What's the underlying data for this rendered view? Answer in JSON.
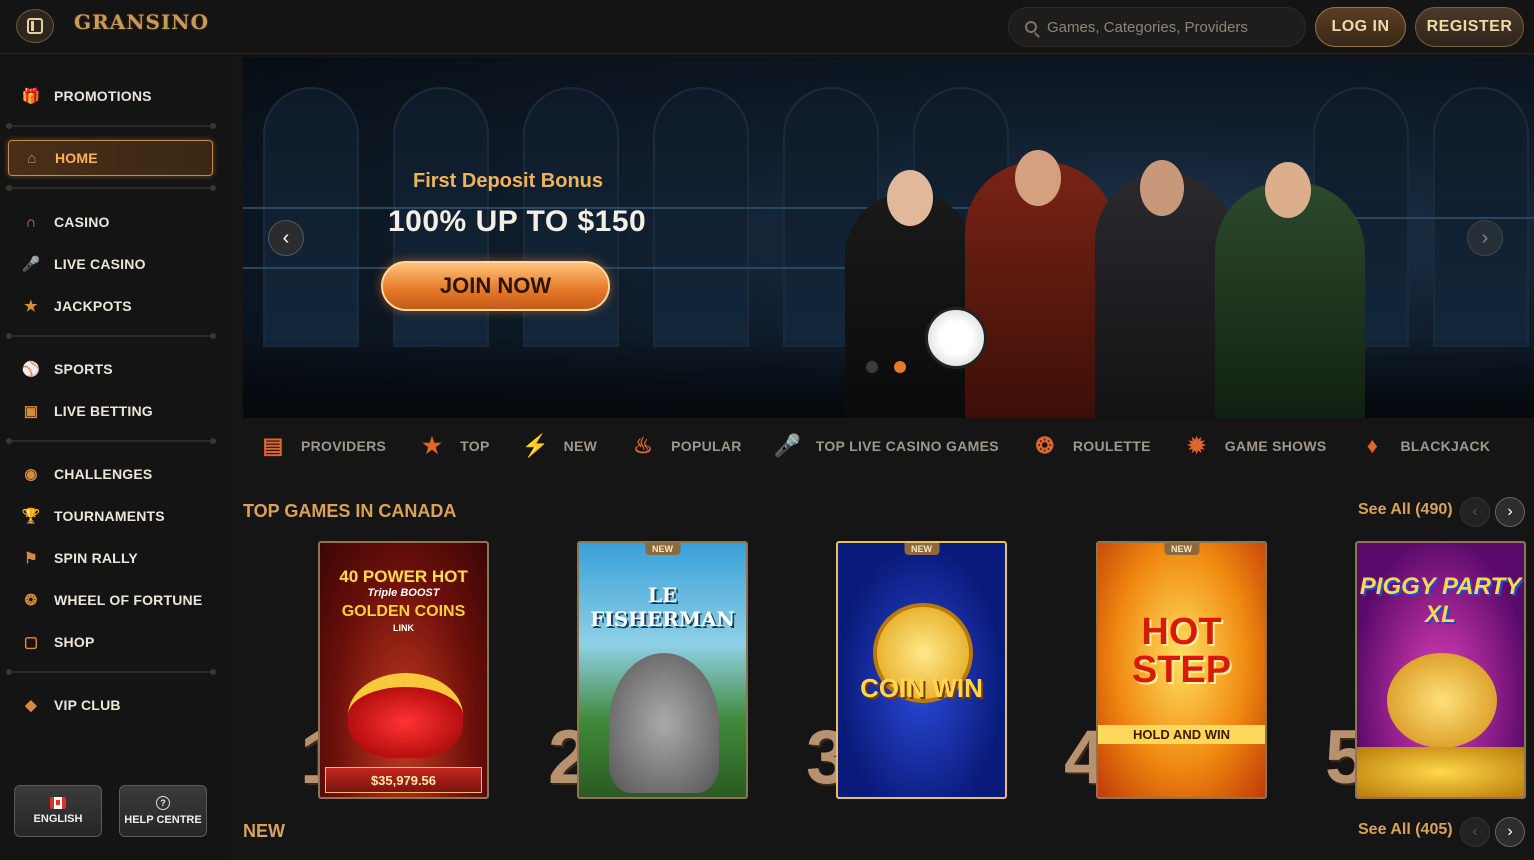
{
  "header": {
    "logo": "GRANSINO",
    "search_placeholder": "Games, Categories, Providers",
    "login_label": "LOG IN",
    "register_label": "REGISTER"
  },
  "sidebar": {
    "items": [
      {
        "label": "PROMOTIONS",
        "icon": "gift-icon"
      },
      {
        "label": "HOME",
        "icon": "home-icon",
        "active": true
      },
      {
        "label": "CASINO",
        "icon": "horseshoe-icon"
      },
      {
        "label": "LIVE CASINO",
        "icon": "microphone-icon"
      },
      {
        "label": "JACKPOTS",
        "icon": "jackpot-icon"
      },
      {
        "label": "SPORTS",
        "icon": "ball-icon"
      },
      {
        "label": "LIVE BETTING",
        "icon": "live-icon"
      },
      {
        "label": "CHALLENGES",
        "icon": "medal-icon"
      },
      {
        "label": "TOURNAMENTS",
        "icon": "trophy-icon"
      },
      {
        "label": "SPIN RALLY",
        "icon": "flag-icon"
      },
      {
        "label": "WHEEL OF FORTUNE",
        "icon": "wheel-icon"
      },
      {
        "label": "SHOP",
        "icon": "shop-icon"
      },
      {
        "label": "VIP CLUB",
        "icon": "diamond-icon"
      }
    ],
    "language_label": "ENGLISH",
    "help_label": "HELP CENTRE"
  },
  "hero": {
    "bonus_title": "First Deposit Bonus",
    "offer": "100% UP TO $150",
    "cta": "JOIN NOW",
    "active_slide": 2,
    "slide_count": 2
  },
  "categories": [
    {
      "label": "PROVIDERS",
      "icon": "slot-machine-icon"
    },
    {
      "label": "TOP",
      "icon": "star-icon"
    },
    {
      "label": "NEW",
      "icon": "lightning-icon"
    },
    {
      "label": "POPULAR",
      "icon": "fire-icon"
    },
    {
      "label": "TOP LIVE CASINO GAMES",
      "icon": "microphone-icon"
    },
    {
      "label": "ROULETTE",
      "icon": "roulette-icon"
    },
    {
      "label": "GAME SHOWS",
      "icon": "wheel-icon"
    },
    {
      "label": "BLACKJACK",
      "icon": "cards-icon"
    }
  ],
  "top_games": {
    "title": "TOP GAMES IN CANADA",
    "see_all": "See All (490)",
    "games": [
      {
        "rank": "1",
        "name": "40 POWER HOT",
        "sub": "Triple BOOST",
        "sub2": "GOLDEN COINS",
        "tag": "LINK",
        "jackpot": "$35,979.56",
        "is_new": false
      },
      {
        "rank": "2",
        "name": "LE FISHERMAN",
        "is_new": true
      },
      {
        "rank": "3",
        "name": "COIN WIN",
        "is_new": true
      },
      {
        "rank": "4",
        "name": "HOT STEP",
        "sub": "HOLD AND WIN",
        "is_new": true
      },
      {
        "rank": "5",
        "name": "PIGGY PARTY XL",
        "is_new": false
      }
    ],
    "new_badge": "NEW"
  },
  "new_games": {
    "title": "NEW",
    "see_all": "See All (405)"
  },
  "colors": {
    "accent": "#e37a26",
    "gold": "#d9a25c",
    "background": "#151516"
  }
}
